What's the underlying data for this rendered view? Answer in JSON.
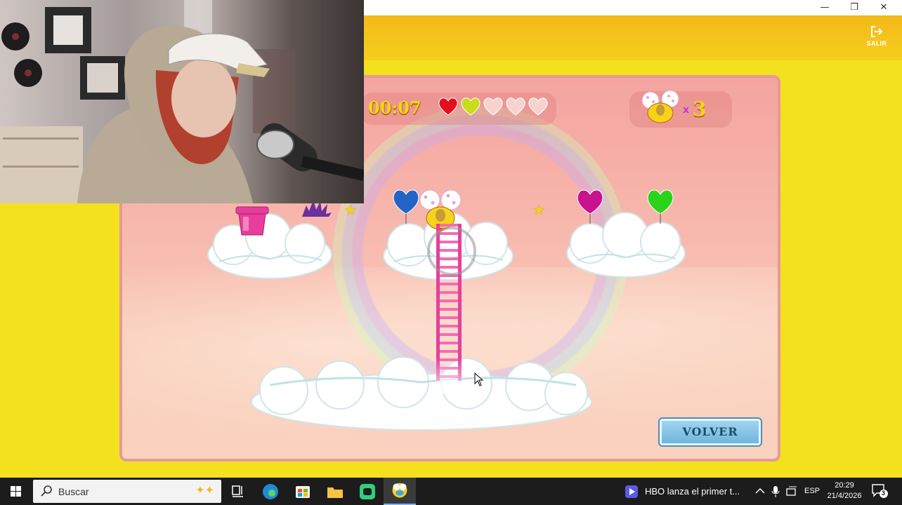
{
  "window": {
    "minimize": "—",
    "restore": "❐",
    "close": "✕"
  },
  "header": {
    "exit_label": "SALIR",
    "exit_icon": "logout-icon"
  },
  "game": {
    "timer": "00:07",
    "hearts": [
      {
        "state": "filled",
        "color": "#e2101c"
      },
      {
        "state": "filled",
        "color": "#c7dc1a"
      },
      {
        "state": "empty",
        "color": "#f6d3cf"
      },
      {
        "state": "empty",
        "color": "#f6d3cf"
      },
      {
        "state": "empty",
        "color": "#f6d3cf"
      }
    ],
    "score_prefix": "x",
    "score": "3",
    "balloons": [
      {
        "name": "blue-heart-balloon",
        "color": "#2464c8"
      },
      {
        "name": "magenta-heart-balloon",
        "color": "#c8128e"
      },
      {
        "name": "green-heart-balloon",
        "color": "#2bd31a"
      }
    ],
    "pot_color": "#e83d9c",
    "back_button": "VOLVER"
  },
  "taskbar": {
    "search_placeholder": "Buscar",
    "news": "HBO lanza el primer t...",
    "language": "ESP",
    "time": "20:29",
    "date": "21/4/2026",
    "notifications": "3"
  }
}
